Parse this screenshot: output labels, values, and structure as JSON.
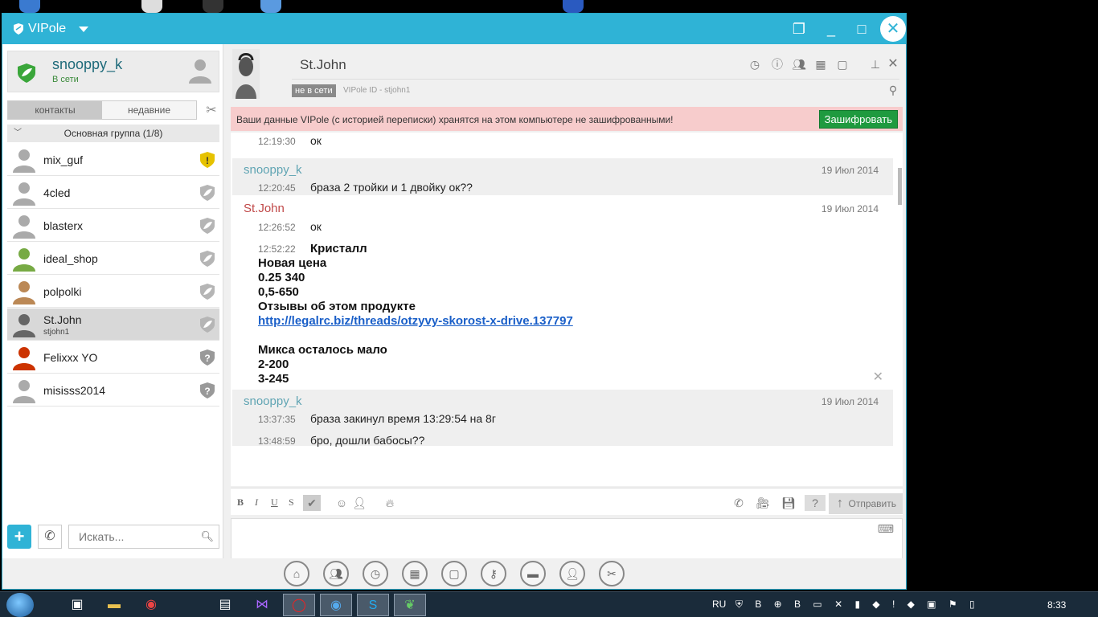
{
  "window": {
    "title": "VIPole"
  },
  "profile": {
    "name": "snooppy_k",
    "status": "В сети"
  },
  "tabs": {
    "contacts": "контакты",
    "recent": "недавние"
  },
  "group": {
    "label": "Основная группа (1/8)"
  },
  "contacts": [
    {
      "name": "mix_guf",
      "sub": "",
      "status_icon": "warning-shield-icon",
      "status_color": "#e6c200"
    },
    {
      "name": "4cled",
      "sub": "",
      "status_icon": "leaf-shield-icon",
      "status_color": "#b5b5b5"
    },
    {
      "name": "blasterx",
      "sub": "",
      "status_icon": "leaf-shield-icon",
      "status_color": "#b5b5b5"
    },
    {
      "name": "ideal_shop",
      "sub": "",
      "status_icon": "leaf-shield-icon",
      "status_color": "#b5b5b5"
    },
    {
      "name": "polpolki",
      "sub": "",
      "status_icon": "leaf-shield-icon",
      "status_color": "#b5b5b5"
    },
    {
      "name": "St.John",
      "sub": "stjohn1",
      "status_icon": "leaf-shield-icon",
      "status_color": "#b5b5b5"
    },
    {
      "name": "Felixxx YO",
      "sub": "",
      "status_icon": "question-shield-icon",
      "status_color": "#999999"
    },
    {
      "name": "misisss2014",
      "sub": "",
      "status_icon": "question-shield-icon",
      "status_color": "#999999"
    }
  ],
  "search": {
    "placeholder": "Искать..."
  },
  "chat": {
    "contact_name": "St.John",
    "status": "не в сети",
    "vipole_id": "VIPole ID - stjohn1",
    "banner_text": "Ваши данные VIPole (с историей переписки) хранятся на этом компьютере не зашифрованными!",
    "encrypt_label": "Зашифровать",
    "messages": {
      "m0": {
        "time": "12:19:30",
        "text": "ок"
      },
      "b1": {
        "sender": "snooppy_k",
        "date": "19 Июл 2014",
        "time": "12:20:45",
        "text": "браза 2 тройки и 1 двойку ок??"
      },
      "b2": {
        "sender": "St.John",
        "date": "19 Июл 2014",
        "time": "12:26:52",
        "text": "ок",
        "time2": "12:52:22",
        "lines": [
          "Кристалл",
          "Новая цена",
          "0.25 340",
          "0,5-650",
          "Отзывы об этом продукте",
          "http://legalrc.biz/threads/otzyvy-skorost-x-drive.137797",
          "Микса осталось мало",
          "2-200",
          "3-245"
        ]
      },
      "b3": {
        "sender": "snooppy_k",
        "date": "19 Июл 2014",
        "time": "13:37:35",
        "text": "браза закинул время 13:29:54 на 8г",
        "time2": "13:48:59",
        "text2": "бро, дошли бабосы??"
      }
    }
  },
  "composer": {
    "bold": "B",
    "italic": "I",
    "underline": "U",
    "strike": "S",
    "send_label": "Отправить"
  },
  "taskbar": {
    "lang": "RU",
    "clock": "8:33"
  }
}
